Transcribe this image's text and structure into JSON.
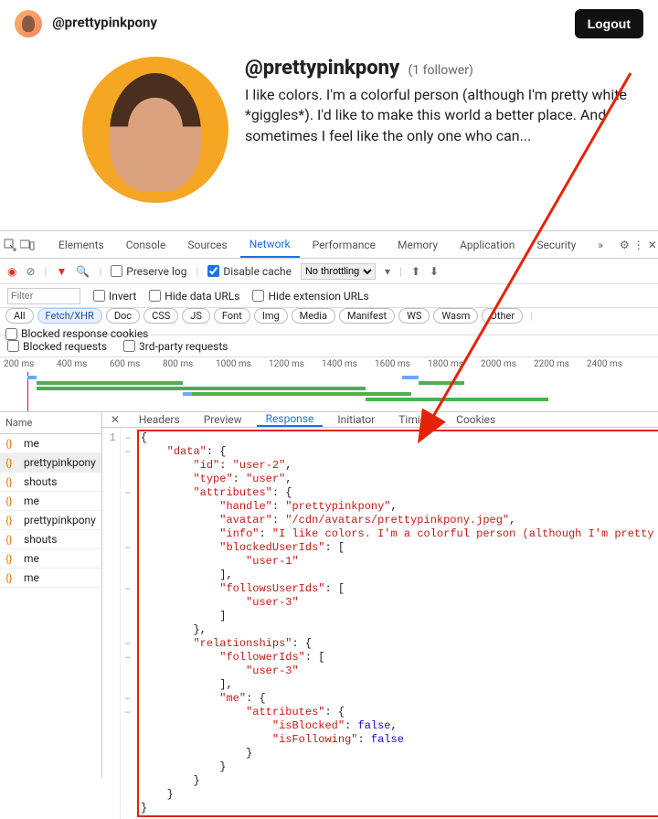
{
  "topbar": {
    "handle": "@prettypinkpony",
    "logout": "Logout"
  },
  "profile": {
    "title": "@prettypinkpony",
    "followers": "(1 follower)",
    "bio": "I like colors. I'm a colorful person (although I'm pretty white *giggles*). I'd like to make this world a better place. And sometimes I feel like the only one who can..."
  },
  "devtools": {
    "tabs": [
      "Elements",
      "Console",
      "Sources",
      "Network",
      "Performance",
      "Memory",
      "Application",
      "Security"
    ],
    "active_tab": "Network",
    "more": "»",
    "toolbar": {
      "filter_placeholder": "Filter",
      "invert": "Invert",
      "hide_data_urls": "Hide data URLs",
      "hide_ext_urls": "Hide extension URLs",
      "preserve_log": "Preserve log",
      "disable_cache": "Disable cache",
      "throttling": "No throttling",
      "blocked_cookies": "Blocked response cookies",
      "blocked_requests": "Blocked requests",
      "third_party": "3rd-party requests"
    },
    "type_filters": [
      "All",
      "Fetch/XHR",
      "Doc",
      "CSS",
      "JS",
      "Font",
      "Img",
      "Media",
      "Manifest",
      "WS",
      "Wasm",
      "Other"
    ],
    "type_selected": "Fetch/XHR",
    "timeline_labels": [
      "200 ms",
      "400 ms",
      "600 ms",
      "800 ms",
      "1000 ms",
      "1200 ms",
      "1400 ms",
      "1600 ms",
      "1800 ms",
      "2000 ms",
      "2200 ms",
      "2400 ms"
    ],
    "req_header": "Name",
    "requests": [
      "me",
      "prettypinkpony",
      "shouts",
      "me",
      "prettypinkpony",
      "shouts",
      "me",
      "me"
    ],
    "selected_request_index": 1,
    "detail_tabs": [
      "Headers",
      "Preview",
      "Response",
      "Initiator",
      "Timing",
      "Cookies"
    ],
    "active_detail_tab": "Response",
    "line_number": "1",
    "json": {
      "data": {
        "id": "user-2",
        "type": "user",
        "attributes": {
          "handle": "prettypinkpony",
          "avatar": "/cdn/avatars/prettypinkpony.jpeg",
          "info": "I like colors. I'm a colorful person (although I'm pretty white ",
          "blockedUserIds": [
            "user-1"
          ],
          "followsUserIds": [
            "user-3"
          ]
        },
        "relationships": {
          "followerIds": [
            "user-3"
          ],
          "me": {
            "attributes": {
              "isBlocked": false,
              "isFollowing": false
            }
          }
        }
      }
    }
  }
}
